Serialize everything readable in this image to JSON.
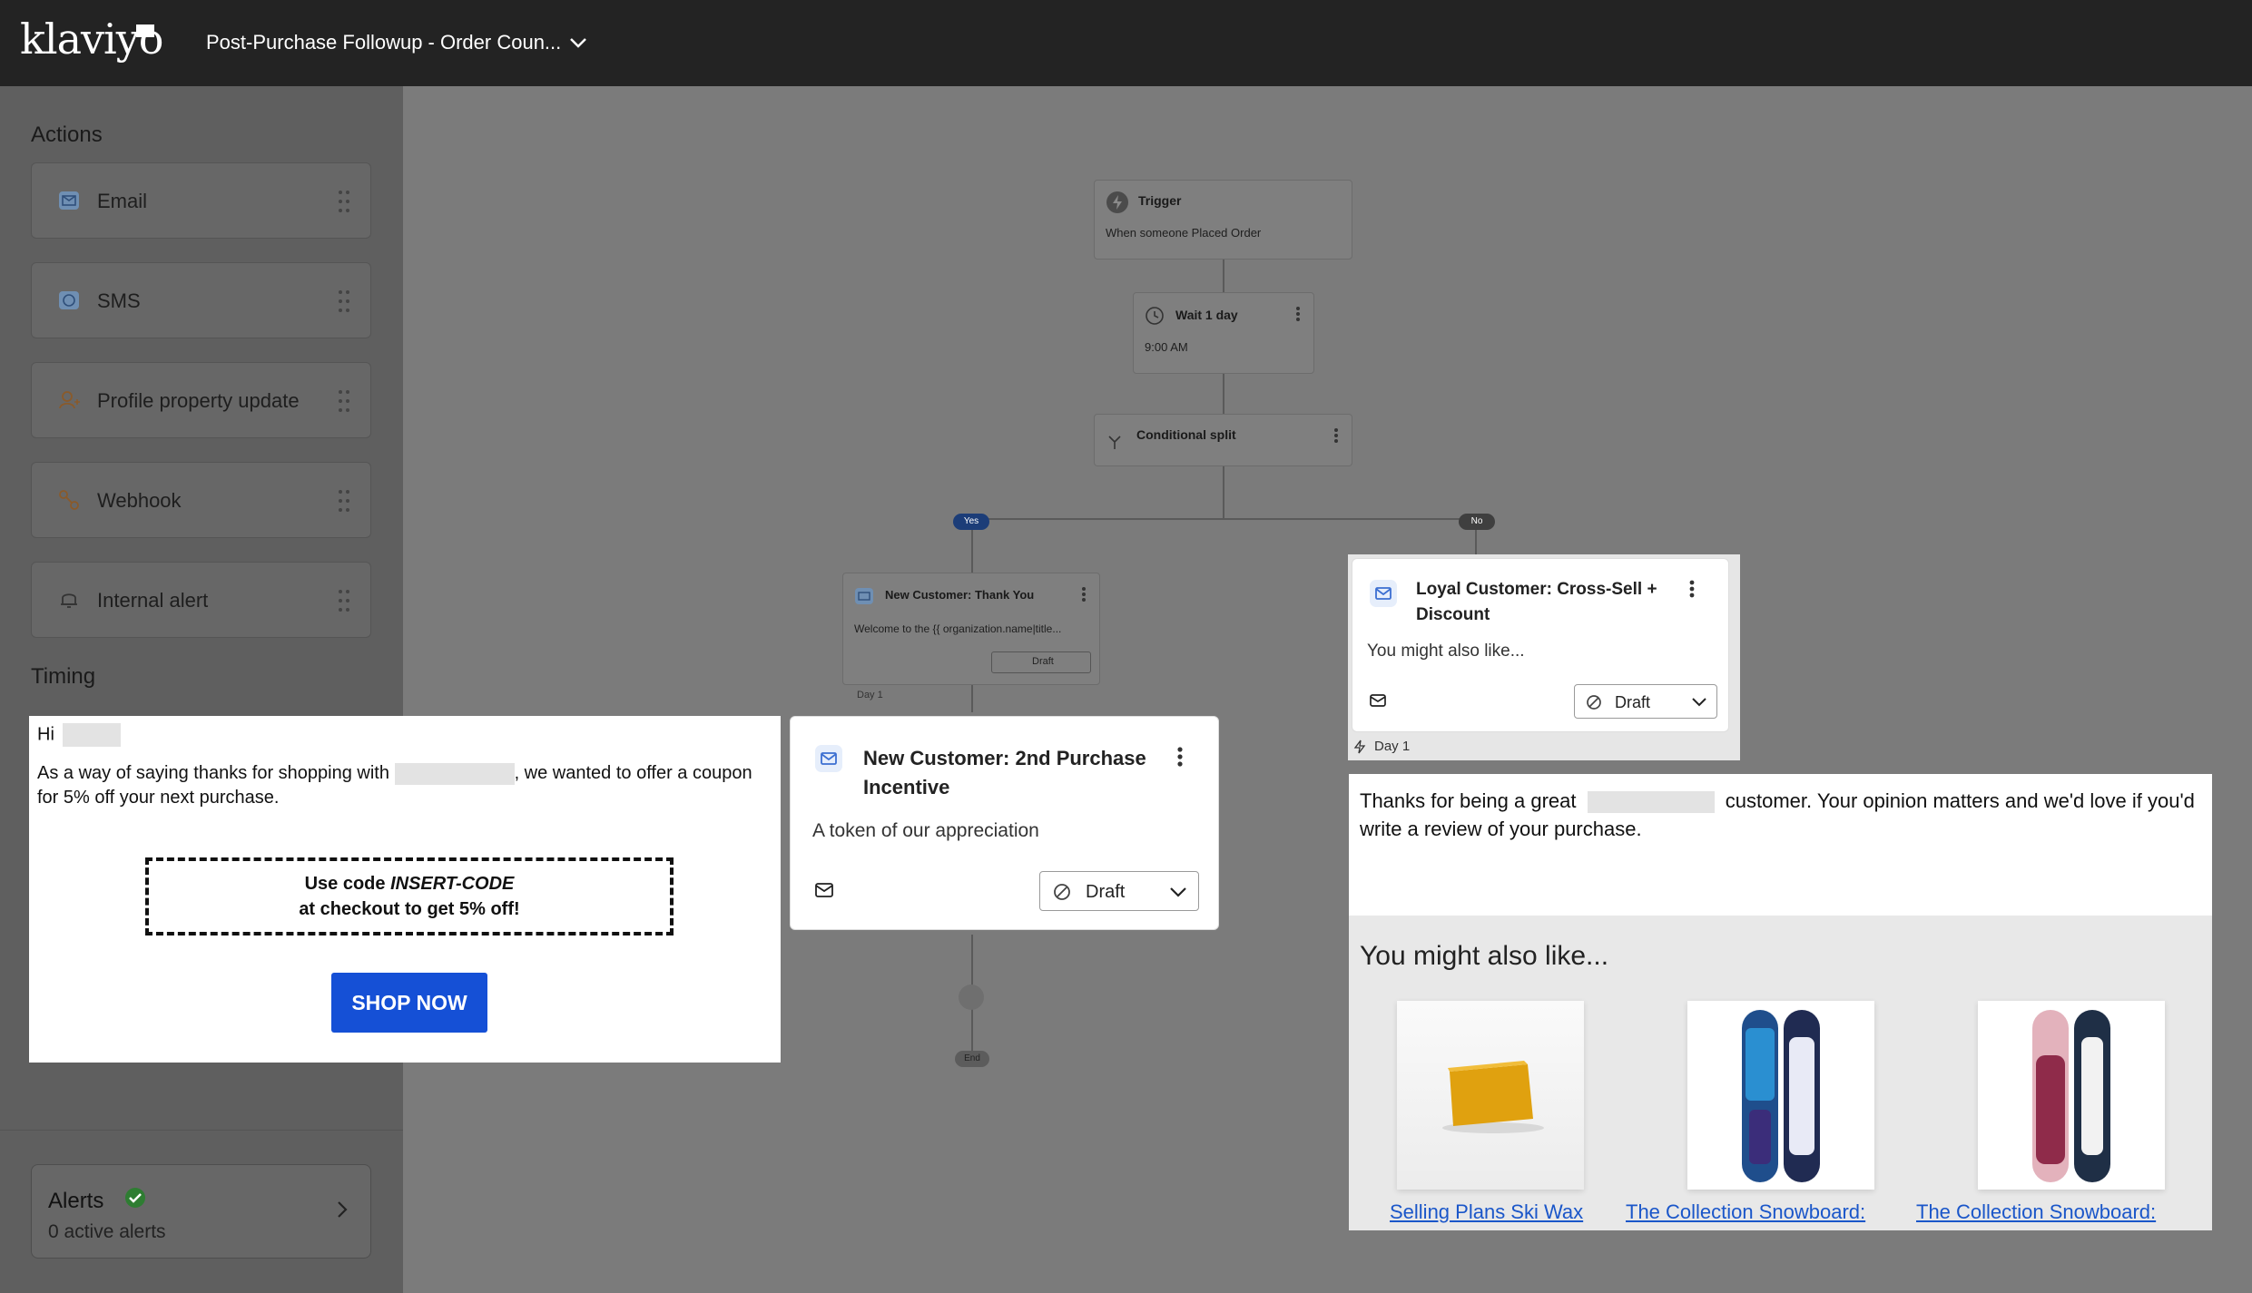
{
  "header": {
    "logo": "klaviyo",
    "flow_title": "Post-Purchase Followup - Order Coun..."
  },
  "sidebar": {
    "actions_heading": "Actions",
    "actions": [
      {
        "label": "Email",
        "icon": "email-icon"
      },
      {
        "label": "SMS",
        "icon": "sms-icon"
      },
      {
        "label": "Profile property update",
        "icon": "profile-icon"
      },
      {
        "label": "Webhook",
        "icon": "webhook-icon"
      },
      {
        "label": "Internal alert",
        "icon": "bell-icon"
      }
    ],
    "timing_heading": "Timing",
    "alerts": {
      "title": "Alerts",
      "subtitle": "0 active alerts"
    }
  },
  "canvas": {
    "trigger": {
      "title": "Trigger",
      "subtitle": "When someone Placed Order"
    },
    "wait": {
      "title": "Wait 1 day",
      "subtitle": "9:00 AM"
    },
    "split": {
      "title": "Conditional split"
    },
    "yes_label": "Yes",
    "no_label": "No",
    "thank_you": {
      "title": "New Customer: Thank You",
      "subtitle": "Welcome to the {{ organization.name|title...",
      "status": "Draft",
      "day": "Day 1"
    },
    "end_label": "End"
  },
  "coupon_email": {
    "greeting": "Hi",
    "body_1": "As a way of saying thanks for shopping with",
    "body_2": ", we wanted to offer a coupon for 5% off your next purchase.",
    "code_prefix": "Use code ",
    "code": "INSERT-CODE",
    "code_suffix": "at checkout to get 5% off!",
    "button": "SHOP NOW"
  },
  "second_purchase_card": {
    "title": "New Customer: 2nd Purchase Incentive",
    "subtitle": "A token of our appreciation",
    "status": "Draft"
  },
  "loyal_card": {
    "title": "Loyal Customer: Cross-Sell + Discount",
    "subtitle": "You might also like...",
    "status": "Draft",
    "day": "Day 1"
  },
  "crosssell_email": {
    "intro_1": "Thanks for being a great",
    "intro_2": "customer. Your opinion matters and we'd love if you'd write a review of your purchase.",
    "heading": "You might also like...",
    "products": [
      {
        "name": "Selling Plans Ski Wax"
      },
      {
        "name": "The Collection Snowboard:"
      },
      {
        "name": "The Collection Snowboard:"
      }
    ]
  },
  "colors": {
    "accent": "#1550d6",
    "header_bg": "#232323",
    "link": "#1a56c9"
  }
}
